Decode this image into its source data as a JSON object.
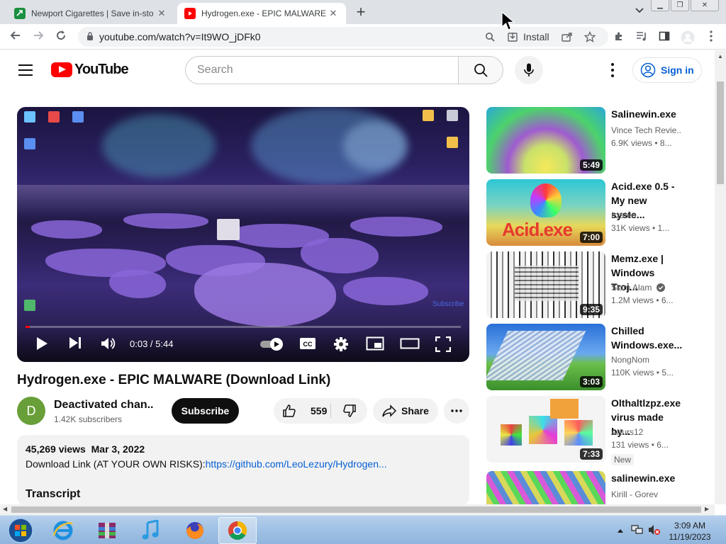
{
  "browser": {
    "tabs": [
      {
        "title": "Newport Cigarettes | Save in-sto",
        "active": false,
        "favicon_color": "#1a8f3f"
      },
      {
        "title": "Hydrogen.exe - EPIC MALWARE (",
        "active": true,
        "favicon_color": "#ff0000"
      }
    ],
    "url": "youtube.com/watch?v=It9WO_jDFk0",
    "install_label": "Install"
  },
  "yt_header": {
    "logo_text": "YouTube",
    "search_placeholder": "Search",
    "signin_label": "Sign in"
  },
  "player": {
    "time_current": "0:03",
    "time_total": "5:44",
    "time_display": "0:03 / 5:44",
    "progress": 0.009,
    "overlay_watermark": "Subscribe"
  },
  "video": {
    "title": "Hydrogen.exe - EPIC MALWARE (Download Link)",
    "channel_initial": "D",
    "channel_name": "Deactivated chan...",
    "subscribers": "1.42K subscribers",
    "subscribe_label": "Subscribe",
    "likes": "559",
    "share_label": "Share"
  },
  "description": {
    "views": "45,269 views",
    "date": "Mar 3, 2022",
    "line_prefix": "Download Link (AT YOUR OWN RISKS):",
    "link": "https://github.com/LeoLezury/Hydrogen...",
    "transcript_heading": "Transcript"
  },
  "recommendations": [
    {
      "title_lines": [
        "Salinewin.exe"
      ],
      "channel": "Vince Tech Revie...",
      "meta": "6.9K views • 8...",
      "duration": "5:49",
      "verified": false,
      "is_new": false
    },
    {
      "title_lines": [
        "Acid.exe 0.5 -",
        "My new syste..."
      ],
      "channel": "Itzsten",
      "meta": "31K views • 1...",
      "duration": "7:00",
      "verified": false,
      "is_new": false,
      "thumb_text": "Acid.exe"
    },
    {
      "title_lines": [
        "Memz.exe |",
        "Windows Troj..."
      ],
      "channel": "Siam Alam",
      "meta": "1.2M views • 6...",
      "duration": "9:35",
      "verified": true,
      "is_new": false
    },
    {
      "title_lines": [
        "Chilled",
        "Windows.exe..."
      ],
      "channel": "NongNom",
      "meta": "110K views • 5...",
      "duration": "3:03",
      "verified": false,
      "is_new": false
    },
    {
      "title_lines": [
        "Olthaltlzpz.exe",
        "virus made by..."
      ],
      "channel": "Arturs12",
      "meta": "131 views • 6...",
      "duration": "7:33",
      "verified": false,
      "is_new": true,
      "new_label": "New"
    },
    {
      "title_lines": [
        "salinewin.exe"
      ],
      "channel": "Kirill - Gorev",
      "meta": "",
      "duration": "",
      "verified": false,
      "is_new": false
    }
  ],
  "taskbar": {
    "time": "3:09 AM",
    "date": "11/19/2023"
  },
  "colors": {
    "youtube_red": "#ff0000",
    "link_blue": "#065fd4",
    "avatar_green": "#689f38",
    "taskbar": "#9fc1e4"
  }
}
